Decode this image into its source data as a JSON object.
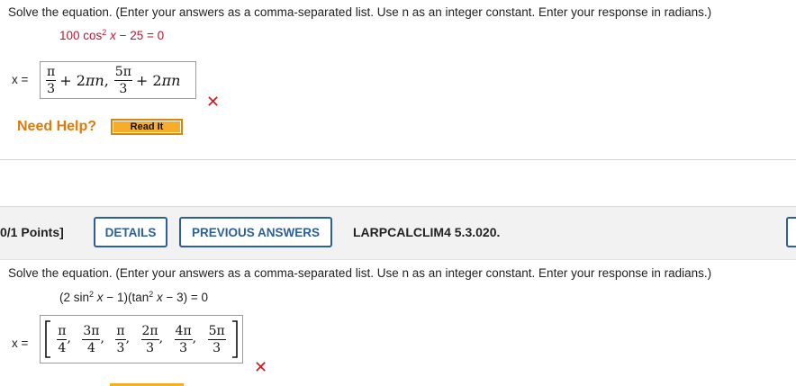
{
  "q1": {
    "instructions": "Solve the equation. (Enter your answers as a comma-separated list. Use n as an integer constant. Enter your response in radians.)",
    "eq_a": "100 cos",
    "eq_exp": "2",
    "eq_var": "x",
    "eq_b": "− 25 = 0",
    "x_label": "x =",
    "answer": {
      "f1_num": "π",
      "f1_den": "3",
      "t1": "+ 2",
      "pi1": "π",
      "n1": "n",
      "sep1": ",",
      "f2_num": "5π",
      "f2_den": "3",
      "t2": "+ 2",
      "pi2": "π",
      "n2": "n"
    },
    "result_mark": "✕",
    "need_help": "Need Help?",
    "read_it": "Read It"
  },
  "q2": {
    "points": "0/1 Points]",
    "details_label": "DETAILS",
    "previous_answers_label": "PREVIOUS ANSWERS",
    "problem_code": "LARPCALCLIM4 5.3.020.",
    "instructions": "Solve the equation. (Enter your answers as a comma-separated list. Use n as an integer constant. Enter your response in radians.)",
    "eq_open": "(2 sin",
    "eq_exp1": "2",
    "eq_var1": "x",
    "eq_mid": "− 1)(tan",
    "eq_exp2": "2",
    "eq_var2": "x",
    "eq_end": "− 3) = 0",
    "x_label": "x =",
    "answer_fracs": [
      {
        "num": "π",
        "den": "4"
      },
      {
        "num": "3π",
        "den": "4"
      },
      {
        "num": "π",
        "den": "3"
      },
      {
        "num": "2π",
        "den": "3"
      },
      {
        "num": "4π",
        "den": "3"
      },
      {
        "num": "5π",
        "den": "3"
      }
    ],
    "answer_sep": ",",
    "result_mark": "✕"
  }
}
